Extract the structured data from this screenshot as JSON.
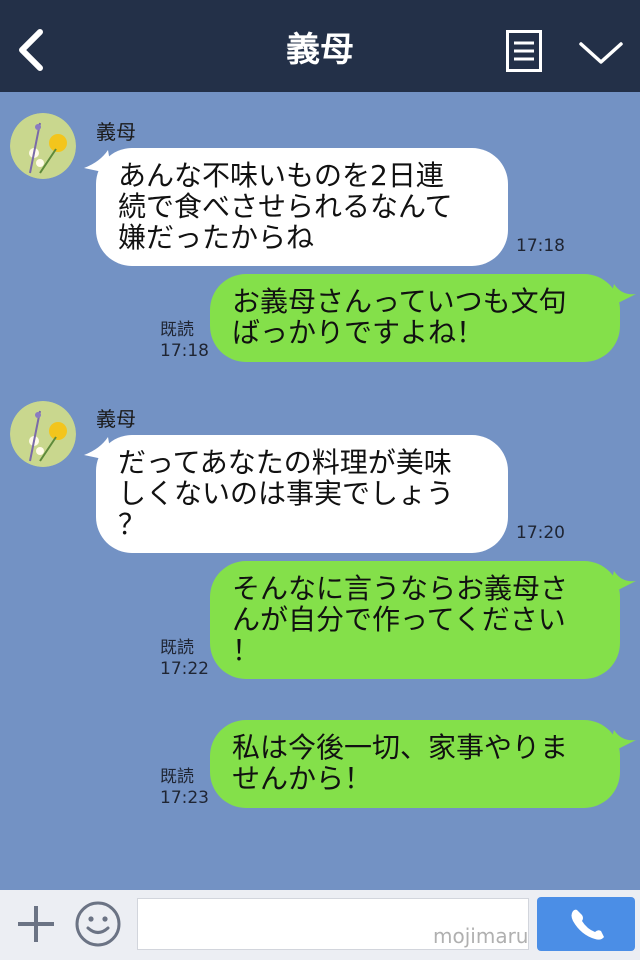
{
  "header": {
    "title": "義母"
  },
  "messages": [
    {
      "sender": "義母",
      "text": "あんな不味いものを2日連続で食べさせられるなんて嫌だったからね",
      "lines": [
        "あんな不味いものを2日連",
        "続で食べさせられるなんて",
        "嫌だったからね"
      ],
      "time": "17:18"
    },
    {
      "text": "お義母さんっていつも文句ばっかりですよね！",
      "lines": [
        "お義母さんっていつも文句",
        "ばっかりですよね！"
      ],
      "read": "既読",
      "time": "17:18"
    },
    {
      "sender": "義母",
      "text": "だってあなたの料理が美味しくないのは事実でしょう？",
      "lines": [
        "だってあなたの料理が美味",
        "しくないのは事実でしょう",
        "？"
      ],
      "time": "17:20"
    },
    {
      "text": "そんなに言うならお義母さんが自分で作ってください！",
      "lines": [
        "そんなに言うならお義母さ",
        "んが自分で作ってください",
        "！"
      ],
      "read": "既読",
      "time": "17:22"
    },
    {
      "text": "私は今後一切、家事やりませんから！",
      "lines": [
        "私は今後一切、家事やりま",
        "せんから！"
      ],
      "read": "既読",
      "time": "17:23"
    }
  ],
  "footer": {
    "input_value": "",
    "watermark": "mojimaru"
  },
  "colors": {
    "header": "#233048",
    "background": "#7392c4",
    "incoming_bubble": "#ffffff",
    "outgoing_bubble": "#84e04a",
    "call_button": "#4b8ee6"
  },
  "icons": {
    "back": "chevron-left-icon",
    "menu": "list-icon",
    "collapse": "chevron-down-icon",
    "avatar": "flower-avatar",
    "add": "plus-icon",
    "sticker": "smiley-icon",
    "call": "phone-icon"
  }
}
